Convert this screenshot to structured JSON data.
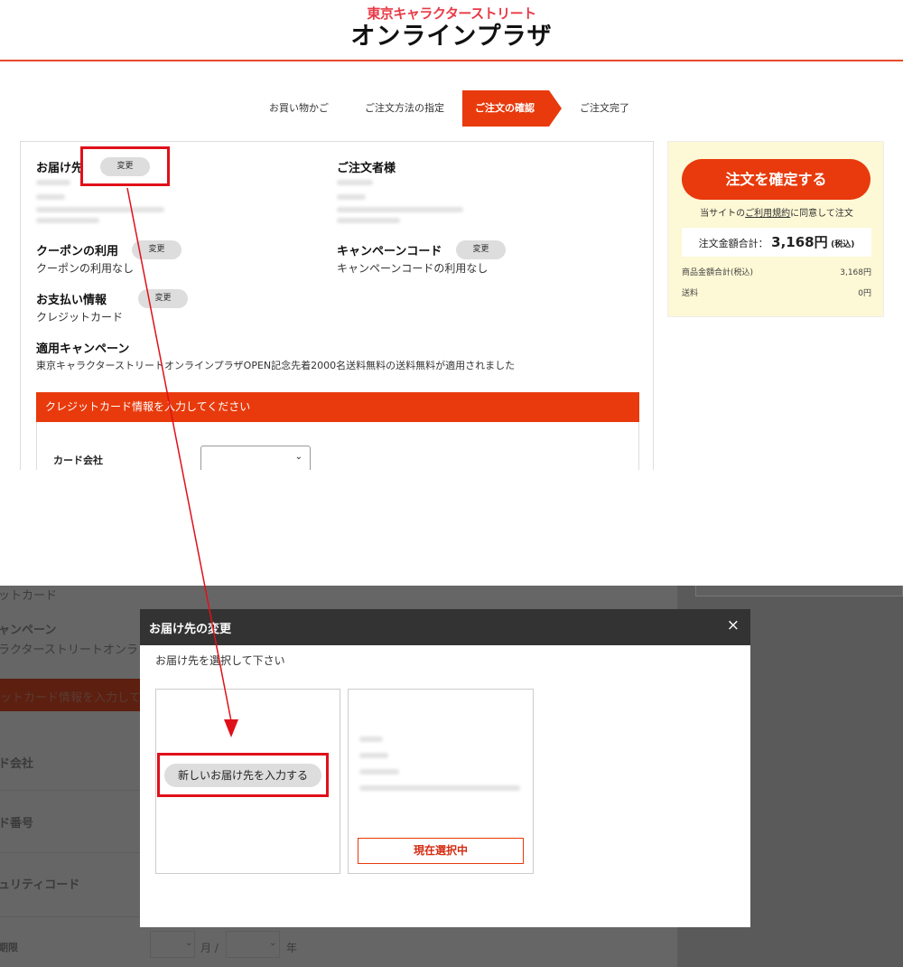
{
  "header": {
    "logo_sub": "東京キャラクターストリート",
    "logo_main": "オンラインプラザ"
  },
  "steps": [
    {
      "label": "お買い物かご",
      "active": false
    },
    {
      "label": "ご注文方法の指定",
      "active": false
    },
    {
      "label": "ご注文の確認",
      "active": true
    },
    {
      "label": "ご注文完了",
      "active": false
    }
  ],
  "main": {
    "delivery": {
      "title": "お届け先",
      "change": "変更"
    },
    "orderer": {
      "title": "ご注文者様"
    },
    "coupon": {
      "title": "クーポンの利用",
      "change": "変更",
      "value": "クーポンの利用なし"
    },
    "campaign_code": {
      "title": "キャンペーンコード",
      "change": "変更",
      "value": "キャンペーンコードの利用なし"
    },
    "payment": {
      "title": "お支払い情報",
      "change": "変更",
      "value": "クレジットカード"
    },
    "applied_campaign": {
      "title": "適用キャンペーン",
      "value": "東京キャラクターストリートオンラインプラザOPEN記念先着2000名送料無料の送料無料が適用されました"
    },
    "credit_bar": "クレジットカード情報を入力してください",
    "card_company_label": "カード会社"
  },
  "summary": {
    "confirm_button": "注文を確定する",
    "terms_prefix": "当サイトの",
    "terms_link": "ご利用規約",
    "terms_suffix": "に同意して注文",
    "total_label": "注文金額合計：",
    "total_value": "3,168円",
    "total_tax": "(税込)",
    "subtotal_label": "商品金額合計(税込)",
    "subtotal_value": "3,168円",
    "shipping_label": "送料",
    "shipping_value": "0円"
  },
  "background_page": {
    "payment_fragment": "ットカード",
    "campaign_fragment": "ャンペーン",
    "campaign_text_fragment": "ラクターストリートオンラ",
    "credit_bar_fragment": "ットカード情報を入力して",
    "card_company_fragment": "ド会社",
    "card_number_fragment": "ド番号",
    "security_fragment": "ュリティコード",
    "expiry_fragment": "期限",
    "month_label": "月 /",
    "year_label": "年"
  },
  "modal": {
    "title": "お届け先の変更",
    "close": "×",
    "subtitle": "お届け先を選択して下さい",
    "new_address_button": "新しいお届け先を入力する",
    "current_selected_button": "現在選択中"
  },
  "colors": {
    "accent": "#e83a0c",
    "logo_pink": "#e83a47",
    "highlight": "#e0101a",
    "summary_bg": "#fdf8d5"
  }
}
